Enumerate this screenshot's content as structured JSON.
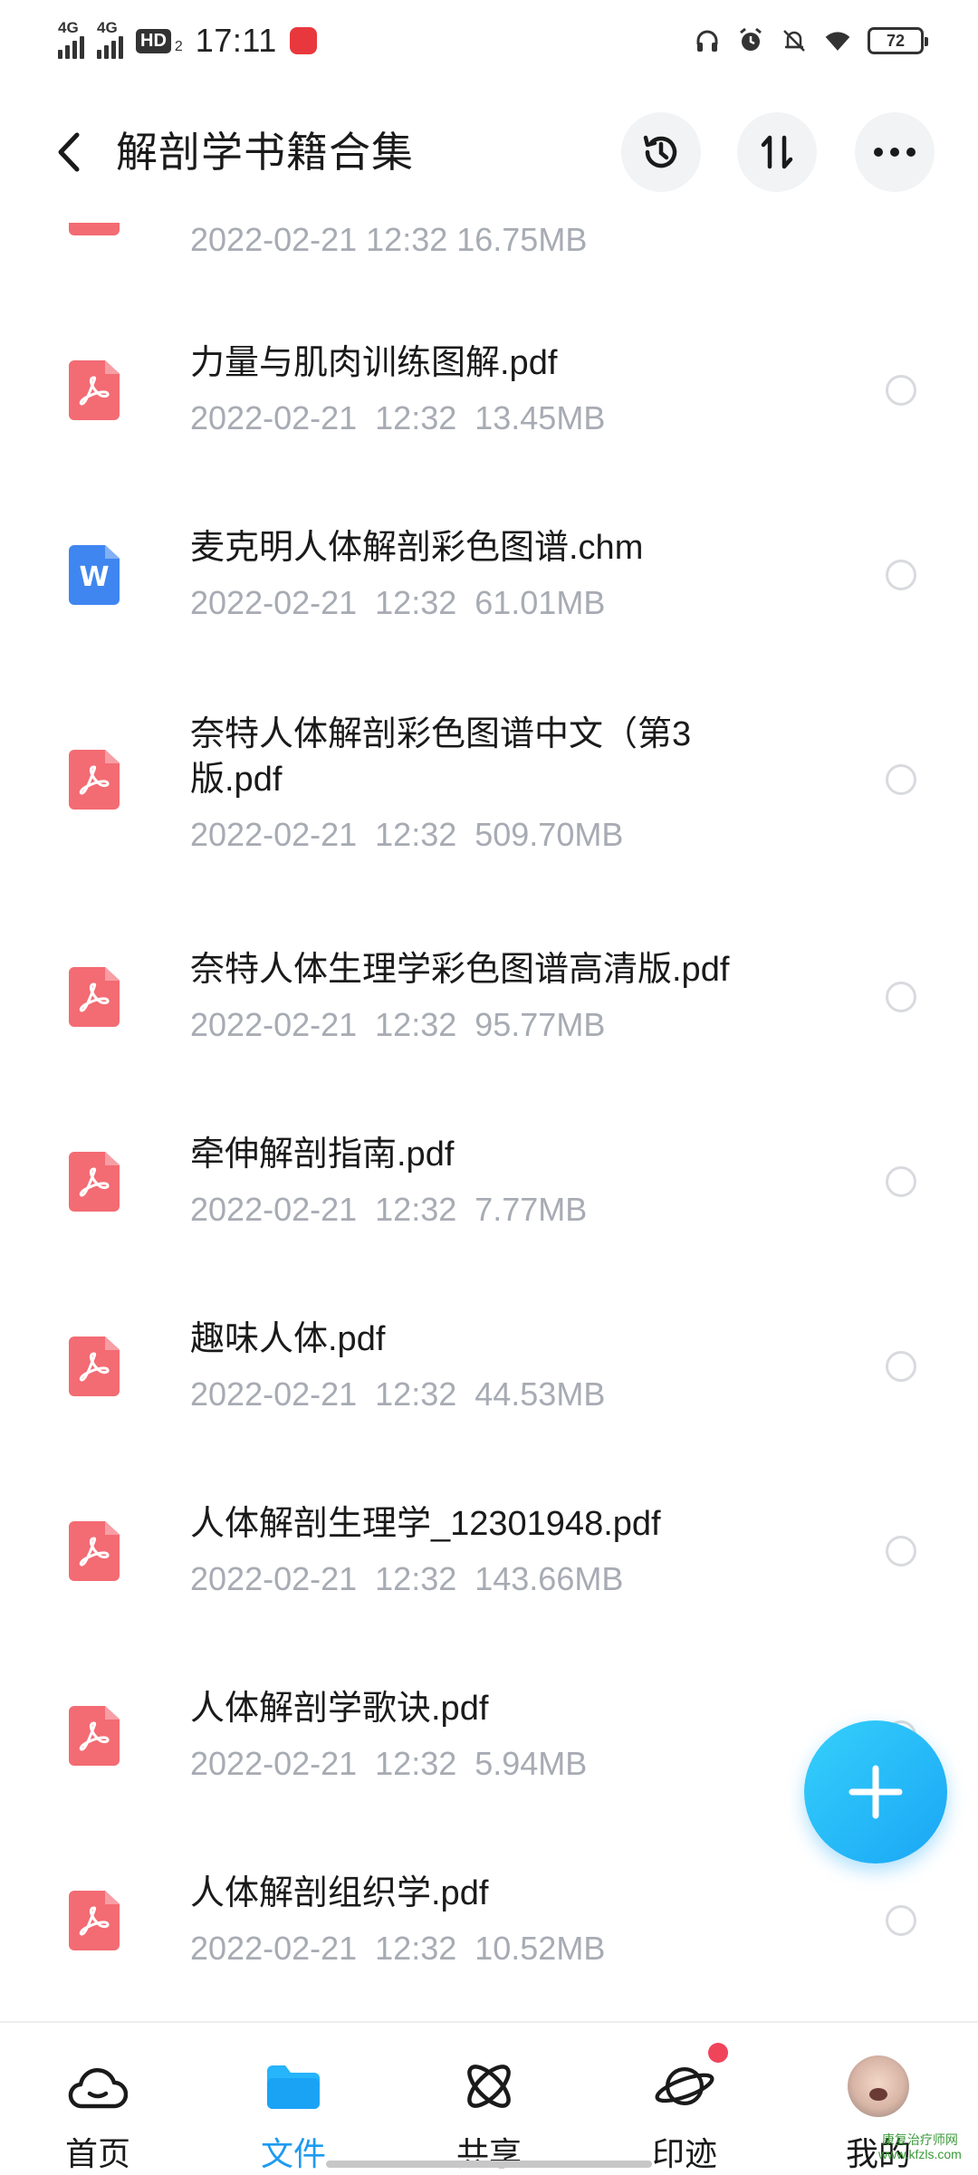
{
  "status_bar": {
    "signal1": "4G",
    "signal2": "4G",
    "hd": "HD",
    "hd_sub": "2",
    "time": "17:11",
    "battery": "72"
  },
  "header": {
    "title": "解剖学书籍合集"
  },
  "partial_row": {
    "meta": "2022-02-21  12:32  16.75MB"
  },
  "files": [
    {
      "name": "力量与肌肉训练图解.pdf",
      "meta": "2022-02-21  12:32  13.45MB",
      "type": "pdf"
    },
    {
      "name": "麦克明人体解剖彩色图谱.chm",
      "meta": "2022-02-21  12:32  61.01MB",
      "type": "doc"
    },
    {
      "name": "奈特人体解剖彩色图谱中文（第3版.pdf",
      "meta": "2022-02-21  12:32  509.70MB",
      "type": "pdf"
    },
    {
      "name": "奈特人体生理学彩色图谱高清版.pdf",
      "meta": "2022-02-21  12:32  95.77MB",
      "type": "pdf"
    },
    {
      "name": "牵伸解剖指南.pdf",
      "meta": "2022-02-21  12:32  7.77MB",
      "type": "pdf"
    },
    {
      "name": "趣味人体.pdf",
      "meta": "2022-02-21  12:32  44.53MB",
      "type": "pdf"
    },
    {
      "name": "人体解剖生理学_12301948.pdf",
      "meta": "2022-02-21  12:32  143.66MB",
      "type": "pdf"
    },
    {
      "name": "人体解剖学歌诀.pdf",
      "meta": "2022-02-21  12:32  5.94MB",
      "type": "pdf"
    },
    {
      "name": "人体解剖组织学.pdf",
      "meta": "2022-02-21  12:32  10.52MB",
      "type": "pdf"
    }
  ],
  "doc_icon_letter": "W",
  "bottom_nav": {
    "home": "首页",
    "files": "文件",
    "share": "共享",
    "footprint": "印迹",
    "me": "我的"
  },
  "watermark": {
    "line1": "康复治疗师网",
    "line2": "www.kfzls.com"
  },
  "colors": {
    "accent": "#1d9bf0",
    "pdf": "#f36b73",
    "doc": "#3f86f0",
    "meta_text": "#a7abb3"
  }
}
